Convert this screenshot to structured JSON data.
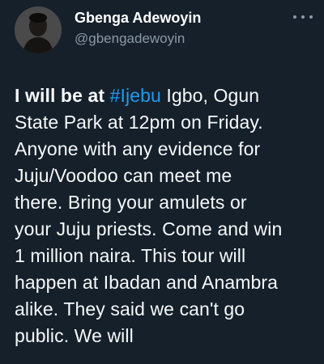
{
  "author": {
    "name": "Gbenga Adewoyin",
    "handle": "@gbengadewoyin"
  },
  "more_icon": "more-horizontal-icon",
  "tweet": {
    "line1_bold": "I will be at ",
    "line1_hashtag": "#Ijebu",
    "line1_rest": " Igbo, Ogun",
    "lines": [
      "State Park at 12pm on Friday.",
      "Anyone with any evidence for",
      "Juju/Voodoo can meet me",
      "there. Bring your amulets or",
      "your Juju priests. Come and win",
      "1 million naira. This tour will",
      "happen at Ibadan and Anambra",
      "alike. They said we can't go",
      "public. We will"
    ]
  },
  "colors": {
    "background": "#15202b",
    "text": "#f7f9f9",
    "secondary": "#8b98a5",
    "link": "#1d9bf0"
  }
}
